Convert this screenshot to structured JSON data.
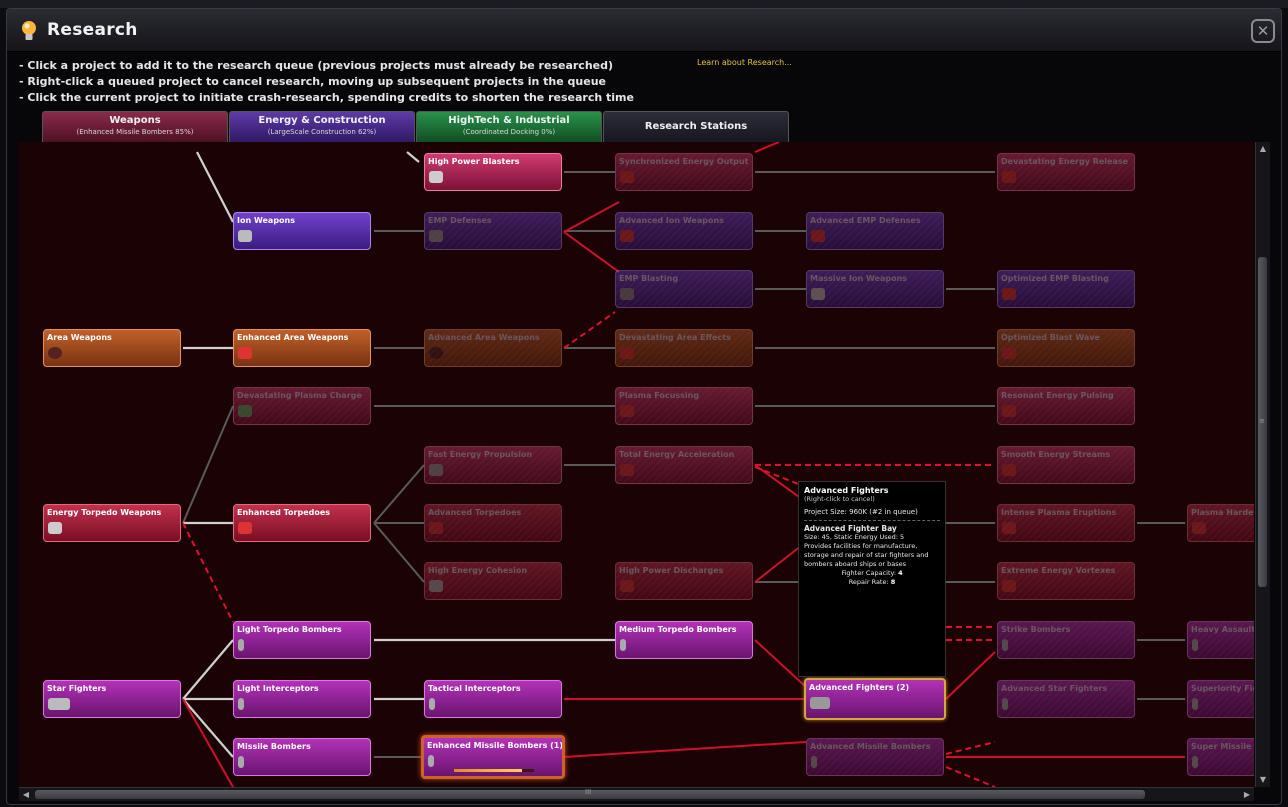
{
  "window": {
    "title": "Research",
    "close_label": "✕"
  },
  "instructions": [
    "- Click a project to add it to the research queue (previous projects must already be researched)",
    "- Right-click a queued project to cancel research, moving up subsequent projects in the queue",
    "- Click the current project to initiate crash-research, spending credits to shorten the research time"
  ],
  "learn_link": "Learn about Research...",
  "tabs": [
    {
      "label": "Weapons",
      "status": "(Enhanced Missile Bombers 85%)"
    },
    {
      "label": "Energy & Construction",
      "status": "(LargeScale Construction 62%)"
    },
    {
      "label": "HighTech & Industrial",
      "status": "(Coordinated Docking 0%)"
    },
    {
      "label": "Research Stations",
      "status": ""
    }
  ],
  "nodes": {
    "high_power_blasters": "High Power Blasters",
    "synchronized_energy_output": "Synchronized Energy Output",
    "devastating_energy_release": "Devastating Energy Release",
    "ion_weapons": "Ion Weapons",
    "emp_defenses": "EMP Defenses",
    "advanced_ion_weapons": "Advanced Ion Weapons",
    "advanced_emp_defenses": "Advanced EMP Defenses",
    "emp_blasting": "EMP Blasting",
    "massive_ion_weapons": "Massive Ion Weapons",
    "optimized_emp_blasting": "Optimized EMP Blasting",
    "area_weapons": "Area Weapons",
    "enhanced_area_weapons": "Enhanced Area Weapons",
    "advanced_area_weapons": "Advanced Area Weapons",
    "devastating_area_effects": "Devastating Area Effects",
    "optimized_blast_wave": "Optimized Blast Wave",
    "devastating_plasma_charge": "Devastating Plasma Charge",
    "plasma_focussing": "Plasma Focussing",
    "resonant_energy_pulsing": "Resonant Energy Pulsing",
    "fast_energy_propulsion": "Fast Energy Propulsion",
    "total_energy_acceleration": "Total Energy Acceleration",
    "smooth_energy_streams": "Smooth Energy Streams",
    "energy_torpedo_weapons": "Energy Torpedo Weapons",
    "enhanced_torpedoes": "Enhanced Torpedoes",
    "advanced_torpedoes": "Advanced Torpedoes",
    "intense_plasma_eruptions": "Intense Plasma Eruptions",
    "plasma_hardening": "Plasma Hardenin",
    "high_energy_cohesion": "High Energy Cohesion",
    "high_power_discharges": "High Power Discharges",
    "extreme_energy_vortexes": "Extreme Energy Vortexes",
    "light_torpedo_bombers": "Light Torpedo Bombers",
    "medium_torpedo_bombers": "Medium Torpedo Bombers",
    "strike_bombers": "Strike Bombers",
    "heavy_assault_bombers": "Heavy Assault Bo",
    "star_fighters": "Star Fighters",
    "light_interceptors": "Light Interceptors",
    "tactical_interceptors": "Tactical Interceptors",
    "advanced_fighters_queued": "Advanced Fighters (2)",
    "advanced_star_fighters": "Advanced Star Fighters",
    "superiority_fighters": "Superiority Fight",
    "missile_bombers": "Missile Bombers",
    "enhanced_missile_bombers_queued": "Enhanced Missile Bombers (1)",
    "advanced_missile_bombers": "Advanced Missile Bombers",
    "super_missile_bombers": "Super Missile Bo"
  },
  "progress": {
    "enhanced_missile_bombers": 0.85
  },
  "tooltip": {
    "title": "Advanced Fighters",
    "subtitle": "(Right-click to cancel)",
    "project_size": "Project Size: 960K  (#2 in queue)",
    "item_name": "Advanced Fighter Bay",
    "item_stats": "Size: 45,  Static Energy Used: 5",
    "description": "Provides facilities for manufacture, storage and repair of star fighters and bombers aboard ships or bases",
    "fighter_capacity_label": "Fighter Capacity:",
    "fighter_capacity_value": "4",
    "repair_rate_label": "Repair Rate:",
    "repair_rate_value": "8"
  },
  "scrollbars": {
    "vertical_grip": "≡",
    "horizontal_grip": "III"
  },
  "colors": {
    "accent_gold": "#d6a83a",
    "link_gold": "#e5c040",
    "weapons_tab": "#8a2a4a",
    "energy_tab": "#5e3aa8",
    "hightech_tab": "#29914a",
    "link_red": "#e0102a"
  }
}
